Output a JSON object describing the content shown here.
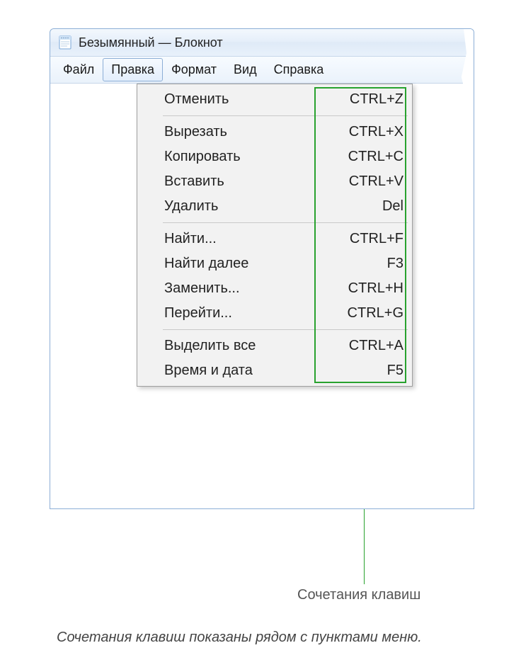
{
  "window": {
    "title": "Безымянный — Блокнот"
  },
  "menubar": {
    "items": [
      {
        "label": "Файл"
      },
      {
        "label": "Правка"
      },
      {
        "label": "Формат"
      },
      {
        "label": "Вид"
      },
      {
        "label": "Справка"
      }
    ],
    "active_index": 1
  },
  "dropdown": {
    "groups": [
      [
        {
          "label": "Отменить",
          "shortcut": "CTRL+Z"
        }
      ],
      [
        {
          "label": "Вырезать",
          "shortcut": "CTRL+X"
        },
        {
          "label": "Копировать",
          "shortcut": "CTRL+C"
        },
        {
          "label": "Вставить",
          "shortcut": "CTRL+V"
        },
        {
          "label": "Удалить",
          "shortcut": "Del"
        }
      ],
      [
        {
          "label": "Найти...",
          "shortcut": "CTRL+F"
        },
        {
          "label": "Найти далее",
          "shortcut": "F3"
        },
        {
          "label": "Заменить...",
          "shortcut": "CTRL+H"
        },
        {
          "label": "Перейти...",
          "shortcut": "CTRL+G"
        }
      ],
      [
        {
          "label": "Выделить все",
          "shortcut": "CTRL+A"
        },
        {
          "label": "Время и дата",
          "shortcut": "F5"
        }
      ]
    ]
  },
  "callout": {
    "label": "Сочетания клавиш"
  },
  "caption": "Сочетания клавиш показаны рядом с пунктами меню."
}
